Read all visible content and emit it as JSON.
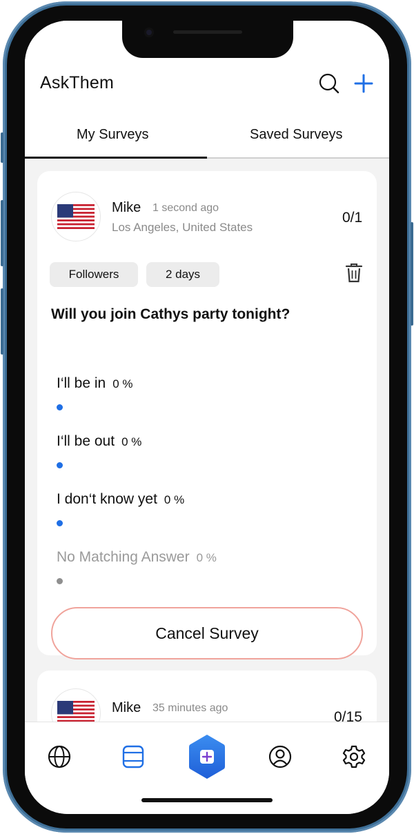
{
  "app": {
    "title": "AskThem"
  },
  "header": {
    "search_icon": "search-icon",
    "add_icon": "plus-icon",
    "tabs": [
      {
        "label": "My Surveys",
        "active": true
      },
      {
        "label": "Saved Surveys",
        "active": false
      }
    ]
  },
  "surveys": [
    {
      "user": "Mike",
      "time_ago": "1 second ago",
      "location": "Los Angeles, United States",
      "count": "0/1",
      "flag": "us-flag",
      "chips": [
        "Followers",
        "2 days"
      ],
      "question": "Will you join Cathys party tonight?",
      "answers": [
        {
          "label": "I‘ll be in",
          "percent": "0 %"
        },
        {
          "label": "I‘ll be out",
          "percent": "0 %"
        },
        {
          "label": "I don‘t know yet",
          "percent": "0 %"
        },
        {
          "label": "No Matching Answer",
          "percent": "0 %"
        }
      ],
      "cancel_label": "Cancel Survey"
    },
    {
      "user": "Mike",
      "time_ago": "35 minutes ago",
      "count": "0/15",
      "flag": "us-flag"
    }
  ],
  "bottom_nav": [
    "globe-icon",
    "surveys-icon",
    "create-survey-icon",
    "profile-icon",
    "settings-icon"
  ],
  "colors": {
    "accent": "#1f6fe5",
    "cancel_border": "#f0a39b",
    "center_button": "#2a7be8"
  }
}
